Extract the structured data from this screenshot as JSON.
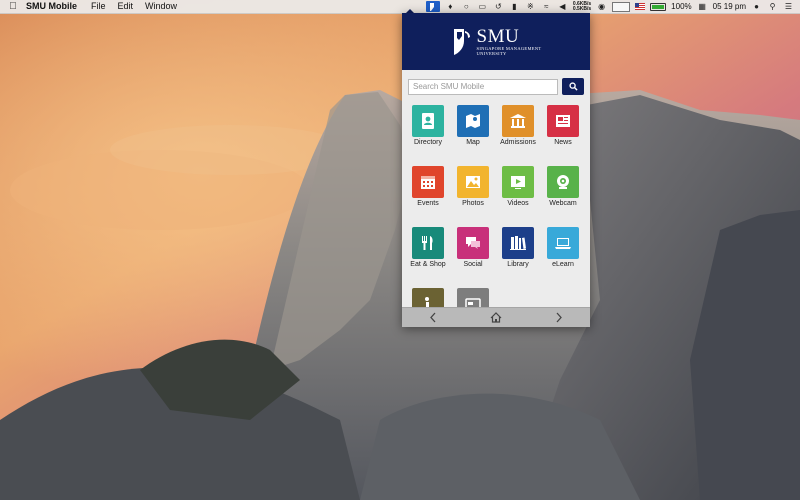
{
  "menubar": {
    "app_name": "SMU Mobile",
    "menus": [
      "File",
      "Edit",
      "Window"
    ],
    "net_up": "0.6KB/s",
    "net_down": "0.5KB/s",
    "battery_percent": "100%",
    "battery_level": 1.0,
    "clock": "05 19 pm"
  },
  "app": {
    "logo_title": "SMU",
    "logo_subtitle_1": "Singapore Management",
    "logo_subtitle_2": "University",
    "search_placeholder": "Search SMU Mobile",
    "tiles": [
      {
        "label": "Directory",
        "icon": "directory-icon",
        "color": "#2db3a0"
      },
      {
        "label": "Map",
        "icon": "map-icon",
        "color": "#1f6fb5"
      },
      {
        "label": "Admissions",
        "icon": "admissions-icon",
        "color": "#e0902a"
      },
      {
        "label": "News",
        "icon": "news-icon",
        "color": "#d63045"
      },
      {
        "label": "Events",
        "icon": "events-icon",
        "color": "#e0452c"
      },
      {
        "label": "Photos",
        "icon": "photos-icon",
        "color": "#f2b42e"
      },
      {
        "label": "Videos",
        "icon": "videos-icon",
        "color": "#6dbd45"
      },
      {
        "label": "Webcam",
        "icon": "webcam-icon",
        "color": "#58b24a"
      },
      {
        "label": "Eat & Shop",
        "icon": "eat-shop-icon",
        "color": "#188a7a"
      },
      {
        "label": "Social",
        "icon": "social-icon",
        "color": "#c8307a"
      },
      {
        "label": "Library",
        "icon": "library-icon",
        "color": "#1d3f8a"
      },
      {
        "label": "eLearn",
        "icon": "elearn-icon",
        "color": "#38a9d9"
      },
      {
        "label": "",
        "icon": "info-icon",
        "color": "#6b6233"
      },
      {
        "label": "",
        "icon": "card-icon",
        "color": "#7d7d7d"
      }
    ]
  },
  "colors": {
    "brand_navy": "#0f1f5c",
    "footer_gray": "#b9b9b9"
  }
}
